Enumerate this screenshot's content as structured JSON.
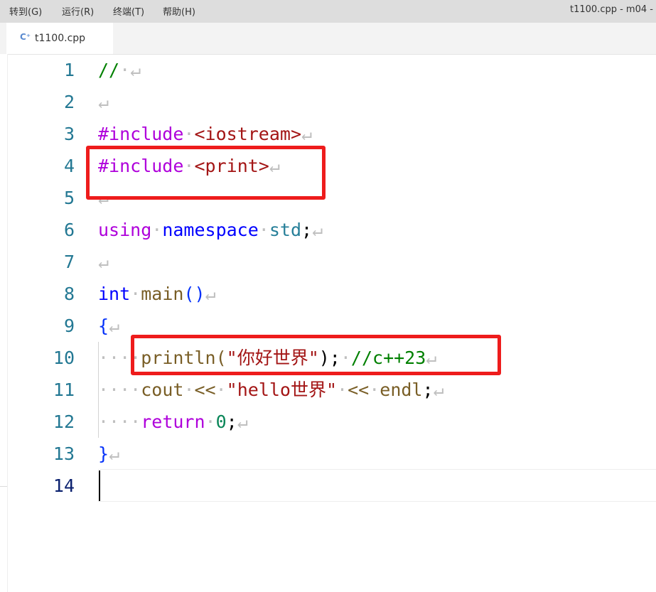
{
  "menu": {
    "items": [
      "转到(G)",
      "运行(R)",
      "终端(T)",
      "帮助(H)"
    ],
    "window_title": "t1100.cpp - m04 -"
  },
  "tabs": [
    {
      "label": "t1100.cpp",
      "icon": "cpp-file-icon",
      "active": true
    }
  ],
  "editor": {
    "current_line": 14,
    "lines": [
      {
        "num": "1",
        "tokens": [
          {
            "t": "//",
            "c": "comment"
          },
          {
            "t": "·",
            "c": "ws"
          },
          {
            "t": "↵",
            "c": "ws"
          }
        ]
      },
      {
        "num": "2",
        "tokens": [
          {
            "t": "↵",
            "c": "ws"
          }
        ]
      },
      {
        "num": "3",
        "tokens": [
          {
            "t": "#include",
            "c": "preproc"
          },
          {
            "t": "·",
            "c": "ws"
          },
          {
            "t": "<iostream>",
            "c": "header"
          },
          {
            "t": "↵",
            "c": "ws"
          }
        ]
      },
      {
        "num": "4",
        "tokens": [
          {
            "t": "#include",
            "c": "preproc"
          },
          {
            "t": "·",
            "c": "ws"
          },
          {
            "t": "<print>",
            "c": "header"
          },
          {
            "t": "↵",
            "c": "ws"
          }
        ]
      },
      {
        "num": "5",
        "tokens": [
          {
            "t": "↵",
            "c": "ws"
          }
        ]
      },
      {
        "num": "6",
        "tokens": [
          {
            "t": "using",
            "c": "ctrl"
          },
          {
            "t": "·",
            "c": "ws"
          },
          {
            "t": "namespace",
            "c": "keyword"
          },
          {
            "t": "·",
            "c": "ws"
          },
          {
            "t": "std",
            "c": "type"
          },
          {
            "t": ";",
            "c": "plain"
          },
          {
            "t": "↵",
            "c": "ws"
          }
        ]
      },
      {
        "num": "7",
        "tokens": [
          {
            "t": "↵",
            "c": "ws"
          }
        ]
      },
      {
        "num": "8",
        "tokens": [
          {
            "t": "int",
            "c": "keyword"
          },
          {
            "t": "·",
            "c": "ws"
          },
          {
            "t": "main",
            "c": "func"
          },
          {
            "t": "()",
            "c": "brace"
          },
          {
            "t": "↵",
            "c": "ws"
          }
        ]
      },
      {
        "num": "9",
        "tokens": [
          {
            "t": "{",
            "c": "brace"
          },
          {
            "t": "↵",
            "c": "ws"
          }
        ]
      },
      {
        "num": "10",
        "tokens": [
          {
            "t": "····",
            "c": "ws"
          },
          {
            "t": "println",
            "c": "func"
          },
          {
            "t": "(",
            "c": "func"
          },
          {
            "t": "\"你好世界\"",
            "c": "string"
          },
          {
            "t": ");",
            "c": "plain"
          },
          {
            "t": "·",
            "c": "ws"
          },
          {
            "t": "//c++23",
            "c": "comment"
          },
          {
            "t": "↵",
            "c": "ws"
          }
        ]
      },
      {
        "num": "11",
        "tokens": [
          {
            "t": "····",
            "c": "ws"
          },
          {
            "t": "cout",
            "c": "func"
          },
          {
            "t": "·",
            "c": "ws"
          },
          {
            "t": "<<",
            "c": "func"
          },
          {
            "t": "·",
            "c": "ws"
          },
          {
            "t": "\"hello世界\"",
            "c": "string"
          },
          {
            "t": "·",
            "c": "ws"
          },
          {
            "t": "<<",
            "c": "func"
          },
          {
            "t": "·",
            "c": "ws"
          },
          {
            "t": "endl",
            "c": "func"
          },
          {
            "t": ";",
            "c": "plain"
          },
          {
            "t": "↵",
            "c": "ws"
          }
        ]
      },
      {
        "num": "12",
        "tokens": [
          {
            "t": "····",
            "c": "ws"
          },
          {
            "t": "return",
            "c": "ctrl"
          },
          {
            "t": "·",
            "c": "ws"
          },
          {
            "t": "0",
            "c": "number"
          },
          {
            "t": ";",
            "c": "plain"
          },
          {
            "t": "↵",
            "c": "ws"
          }
        ]
      },
      {
        "num": "13",
        "tokens": [
          {
            "t": "}",
            "c": "brace"
          },
          {
            "t": "↵",
            "c": "ws"
          }
        ]
      },
      {
        "num": "14",
        "tokens": []
      }
    ]
  },
  "annotations": {
    "color": "#ee1c1c"
  }
}
